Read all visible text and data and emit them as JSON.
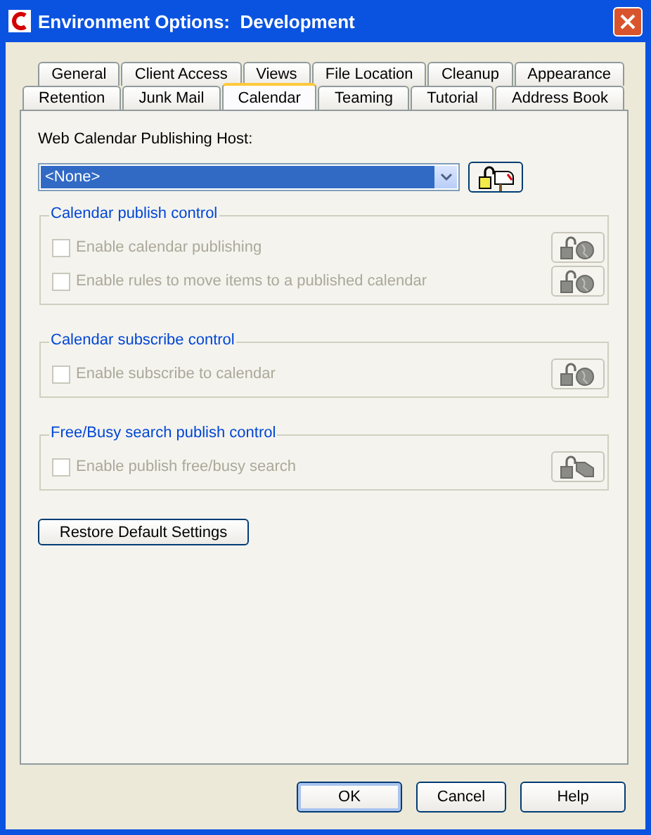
{
  "window": {
    "title": "Environment Options:  Development"
  },
  "tab_rows": [
    [
      {
        "label": "General",
        "selected": false
      },
      {
        "label": "Client Access",
        "selected": false
      },
      {
        "label": "Views",
        "selected": false
      },
      {
        "label": "File Location",
        "selected": false
      },
      {
        "label": "Cleanup",
        "selected": false
      },
      {
        "label": "Appearance",
        "selected": false
      }
    ],
    [
      {
        "label": "Retention",
        "selected": false
      },
      {
        "label": "Junk Mail",
        "selected": false
      },
      {
        "label": "Calendar",
        "selected": true
      },
      {
        "label": "Teaming",
        "selected": false
      },
      {
        "label": "Tutorial",
        "selected": false
      },
      {
        "label": "Address Book",
        "selected": false
      }
    ]
  ],
  "host": {
    "label": "Web Calendar Publishing Host:",
    "value": "<None>",
    "lock_button": {
      "kind": "mailbox"
    }
  },
  "groups": [
    {
      "title": "Calendar publish control",
      "options": [
        {
          "label": "Enable calendar publishing",
          "checked": false,
          "disabled": true,
          "kind": "globe"
        },
        {
          "label": "Enable rules to move items to a published calendar",
          "checked": false,
          "disabled": true,
          "kind": "globe"
        }
      ]
    },
    {
      "title": "Calendar subscribe control",
      "options": [
        {
          "label": "Enable subscribe to calendar",
          "checked": false,
          "disabled": true,
          "kind": "globe"
        }
      ]
    },
    {
      "title": "Free/Busy search publish control",
      "options": [
        {
          "label": "Enable publish free/busy search",
          "checked": false,
          "disabled": true,
          "kind": "card"
        }
      ]
    }
  ],
  "restore_button": "Restore Default Settings",
  "buttons": [
    {
      "label": "OK",
      "default": true
    },
    {
      "label": "Cancel",
      "default": false
    },
    {
      "label": "Help",
      "default": false
    }
  ]
}
